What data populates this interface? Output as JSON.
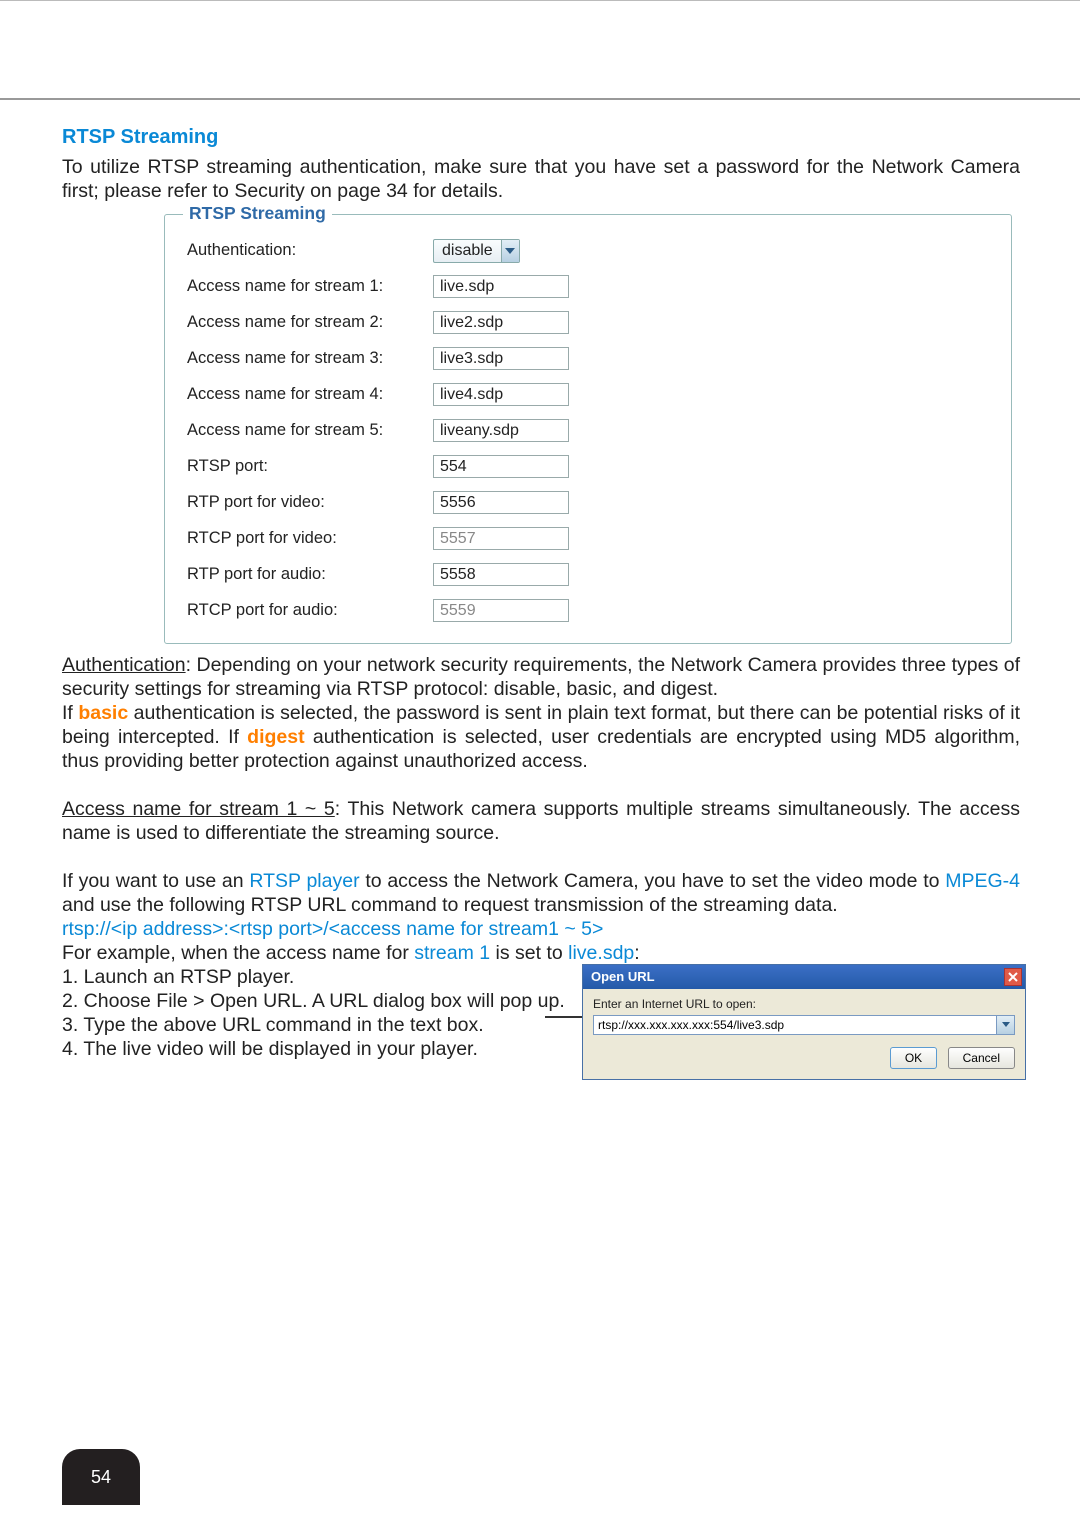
{
  "pageNumber": "54",
  "heading": "RTSP Streaming",
  "intro": "To utilize RTSP streaming authentication, make sure that you have set a password for the Network Camera first; please refer to Security on page 34 for details.",
  "panel": {
    "legend": "RTSP Streaming",
    "rows": {
      "auth": {
        "label": "Authentication:",
        "value": "disable"
      },
      "s1": {
        "label": "Access name for stream 1:",
        "value": "live.sdp"
      },
      "s2": {
        "label": "Access name for stream 2:",
        "value": "live2.sdp"
      },
      "s3": {
        "label": "Access name for stream 3:",
        "value": "live3.sdp"
      },
      "s4": {
        "label": "Access name for stream 4:",
        "value": "live4.sdp"
      },
      "s5": {
        "label": "Access name for stream 5:",
        "value": "liveany.sdp"
      },
      "rtsp": {
        "label": "RTSP port:",
        "value": "554"
      },
      "rtpv": {
        "label": "RTP port for video:",
        "value": "5556"
      },
      "rtcpv": {
        "label": "RTCP port for video:",
        "value": "5557"
      },
      "rtpa": {
        "label": "RTP port for audio:",
        "value": "5558"
      },
      "rtcpa": {
        "label": "RTCP port for audio:",
        "value": "5559"
      }
    }
  },
  "body": {
    "p1_a": "Authentication",
    "p1_b": ": Depending on your network security requirements, the Network Camera provides three types of security settings for streaming via RTSP protocol: disable, basic, and digest.",
    "p2_a": "If ",
    "p2_basic": "basic",
    "p2_b": " authentication is selected, the password is sent in plain text format, but there can be potential risks of it being intercepted. If ",
    "p2_digest": "digest",
    "p2_c": " authentication is selected, user credentials are encrypted using MD5 algorithm, thus providing better protection against unauthorized access.",
    "p3_a": "Access name for stream 1 ~ 5",
    "p3_b": ": This Network camera supports multiple streams simultaneously. The access name is used to differentiate the streaming source.",
    "p4_a": "If you want to use an ",
    "p4_rtspplayer": "RTSP player",
    "p4_b": " to access the Network Camera, you have to set the video mode to ",
    "p4_mpeg4": "MPEG-4",
    "p4_c": " and use the following RTSP URL command to request transmission of the streaming data.",
    "url_line": "rtsp://<ip address>:<rtsp port>/<access name for stream1 ~ 5>",
    "p5_a": "For example, when the access name for ",
    "p5_stream1": "stream 1",
    "p5_b": " is set to ",
    "p5_livesdp": "live.sdp",
    "p5_c": ":",
    "steps": {
      "s1": "1. Launch an RTSP player.",
      "s2": "2. Choose File > Open URL. A URL dialog box will pop up.",
      "s3": "3. Type the above URL command in the text box.",
      "s4": "4. The live video will be displayed in your player."
    }
  },
  "dialog": {
    "title": "Open URL",
    "hint": "Enter an Internet URL to open:",
    "value": "rtsp://xxx.xxx.xxx.xxx:554/live3.sdp",
    "ok": "OK",
    "cancel": "Cancel"
  }
}
